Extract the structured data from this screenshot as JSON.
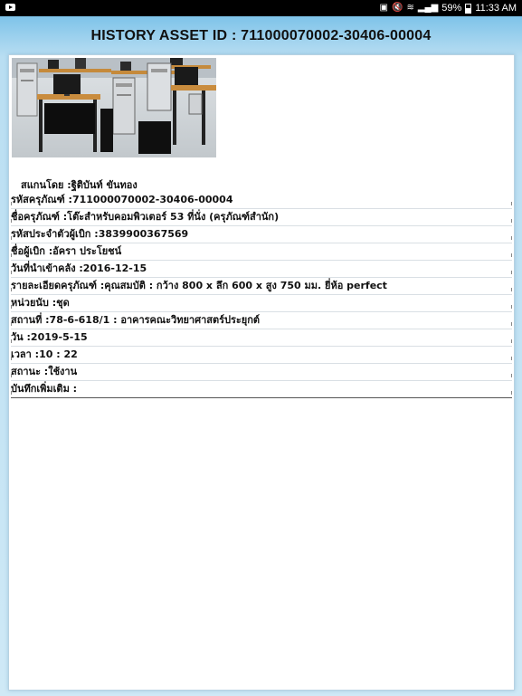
{
  "status_bar": {
    "left_icon": "youtube-icon",
    "icons": [
      "image-icon",
      "mute-icon",
      "wifi-icon",
      "signal-icon"
    ],
    "battery_percent": "59%",
    "time": "11:33 AM"
  },
  "header": {
    "title": "HISTORY ASSET ID : 711000070002-30406-00004"
  },
  "asset": {
    "photo_description_icon": "computer-lab-photo",
    "scanned_by": "สแกนโดย :ฐิติบันท์  ขันทอง",
    "fields": [
      "รหัสครุภัณฑ์ :711000070002-30406-00004",
      "ชื่อครุภัณฑ์ :โต๊ะสำหรับคอมพิวเตอร์ 53 ที่นั่ง (ครุภัณฑ์สำนัก)",
      "รหัสประจำตัวผู้เบิก :3839900367569",
      "ชื่อผู้เบิก :อัครา ประโยชน์",
      "วันที่นำเข้าคลัง :2016-12-15",
      "รายละเอียดครุภัณฑ์ :คุณสมบัติ : กว้าง 800 x ลึก 600 x สูง 750 มม. ยี่ห้อ perfect",
      "หน่วยนับ :ชุด",
      "สถานที่ :78-6-618/1 : อาคารคณะวิทยาศาสตร์ประยุกต์",
      "วัน :2019-5-15",
      "เวลา :10 : 22",
      "สถานะ :ใช้งาน",
      "บันทึกเพิ่มเติม :"
    ]
  }
}
